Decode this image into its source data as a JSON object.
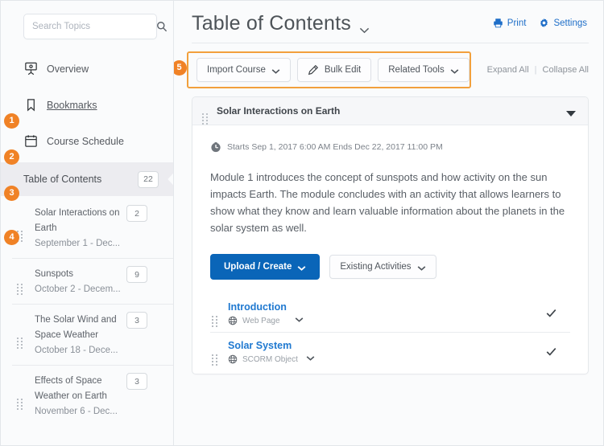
{
  "sidebar": {
    "search": {
      "placeholder": "Search Topics",
      "value": "",
      "icon": "search-icon"
    },
    "nav": [
      {
        "badge": "1",
        "label": "Overview",
        "icon": "presentation-icon",
        "active": false,
        "link": false
      },
      {
        "badge": "2",
        "label": "Bookmarks",
        "icon": "bookmark-icon",
        "active": false,
        "link": true
      },
      {
        "badge": "3",
        "label": "Course Schedule",
        "icon": "calendar-icon",
        "active": false,
        "link": false
      },
      {
        "badge": "4",
        "label": "Table of Contents",
        "icon": "toc-icon",
        "active": true,
        "count": "22"
      }
    ],
    "topics": [
      {
        "title": "Solar Interactions on Earth",
        "dates": "September 1 - Dec...",
        "count": "2"
      },
      {
        "title": "Sunspots",
        "dates": "October 2 - Decem...",
        "count": "9"
      },
      {
        "title": "The Solar Wind and Space Weather",
        "dates": "October 18 - Dece...",
        "count": "3"
      },
      {
        "title": "Effects of Space Weather on Earth",
        "dates": "November 6 - Dec...",
        "count": "3"
      }
    ]
  },
  "header": {
    "title": "Table of Contents",
    "title_caret_icon": "chevron-down-icon",
    "actions": [
      {
        "label": "Print",
        "icon": "printer-icon"
      },
      {
        "label": "Settings",
        "icon": "gear-icon"
      }
    ]
  },
  "toolbar": {
    "callout_number": "5",
    "buttons": [
      {
        "label": "Import Course",
        "icon": "chevron-down-icon",
        "has_caret": true,
        "has_pencil": false
      },
      {
        "label": "Bulk Edit",
        "icon": "pencil-icon",
        "has_caret": false,
        "has_pencil": true
      },
      {
        "label": "Related Tools",
        "icon": "chevron-down-icon",
        "has_caret": true,
        "has_pencil": false
      }
    ],
    "expand_all": "Expand All",
    "separator": "|",
    "collapse_all": "Collapse All"
  },
  "module": {
    "title": "Solar Interactions on Earth",
    "collapse_icon": "caret-down-icon",
    "dates": "Starts Sep 1, 2017 6:00 AM  Ends Dec 22, 2017 11:00 PM",
    "clock_icon": "clock-icon",
    "description": "Module 1 introduces the concept of sunspots and how activity on the sun impacts Earth. The module concludes with an activity that allows learners to show what they know and learn valuable information about the planets in the solar system as well.",
    "primary_button": "Upload / Create",
    "secondary_button": "Existing Activities",
    "topics": [
      {
        "title": "Introduction",
        "type": "Web Page",
        "type_icon": "globe-icon",
        "status_icon": "check-icon"
      },
      {
        "title": "Solar System",
        "type": "SCORM Object",
        "type_icon": "globe-icon",
        "status_icon": "check-icon"
      }
    ]
  },
  "colors": {
    "accent_orange": "#f08226",
    "link_blue": "#1e6ec8",
    "primary_blue": "#0a65b8",
    "topic_link_blue": "#2079d0",
    "callout_border": "#f2a03c"
  }
}
